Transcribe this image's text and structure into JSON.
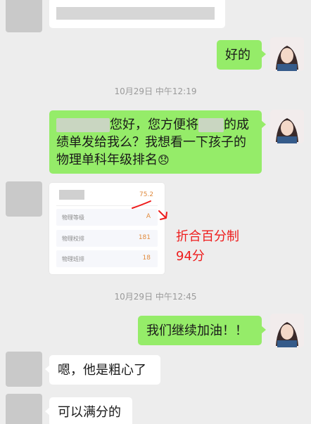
{
  "messages": {
    "reply_ok": "好的",
    "request_pre": "您好，您方便将",
    "request_mid": "的成绩单发给我么？我想看一下孩子的物理单科年级排名",
    "request_emoji": "😞",
    "encourage": "我们继续加油！！",
    "careless": "嗯，他是粗心了",
    "full_score": "可以满分的"
  },
  "timestamps": {
    "t1": "10月29日 中午12:19",
    "t2": "10月29日 中午12:45"
  },
  "score_card": {
    "total_value": "75.2",
    "rows": [
      {
        "label": "物理等级",
        "value": "A"
      },
      {
        "label": "物理校排",
        "value": "181"
      },
      {
        "label": "物理班排",
        "value": "18"
      }
    ]
  },
  "annotation": {
    "line1": "折合百分制",
    "line2": "94分"
  },
  "colors": {
    "background": "#ededed",
    "sent_bubble": "#95ec69",
    "received_bubble": "#ffffff",
    "annotation_red": "#ee1c1c"
  }
}
